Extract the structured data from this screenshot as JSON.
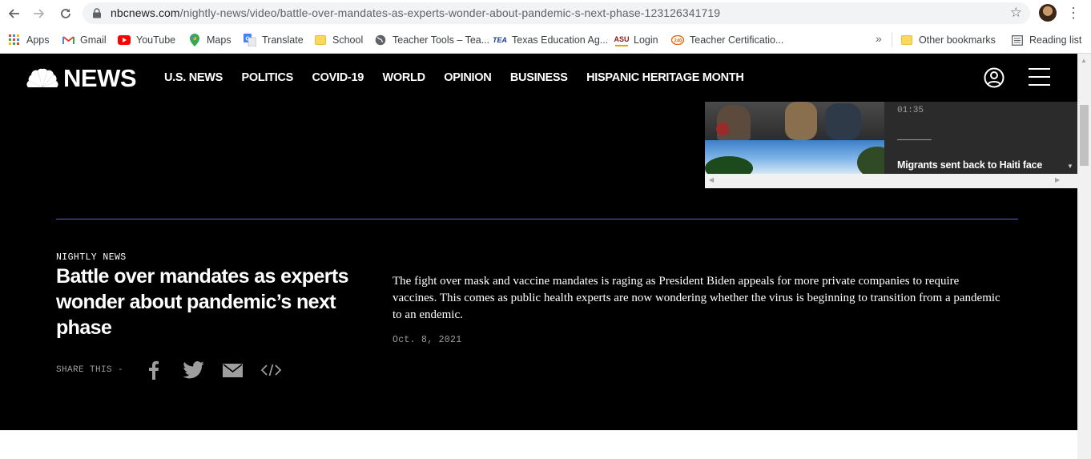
{
  "browser": {
    "url_host": "nbcnews.com",
    "url_path": "/nightly-news/video/battle-over-mandates-as-experts-wonder-about-pandemic-s-next-phase-123126341719",
    "bookmarks": [
      {
        "label": "Apps",
        "icon": "apps-grid-icon"
      },
      {
        "label": "Gmail",
        "icon": "gmail-icon"
      },
      {
        "label": "YouTube",
        "icon": "youtube-icon"
      },
      {
        "label": "Maps",
        "icon": "maps-pin-icon"
      },
      {
        "label": "Translate",
        "icon": "translate-icon"
      },
      {
        "label": "School",
        "icon": "folder-icon"
      },
      {
        "label": "Teacher Tools – Tea...",
        "icon": "globe-icon"
      },
      {
        "label": "Texas Education Ag...",
        "icon": "tea-icon"
      },
      {
        "label": "Login",
        "icon": "asu-icon"
      },
      {
        "label": "Teacher Certificatio...",
        "icon": "certification-icon"
      }
    ],
    "overflow_chevron": "»",
    "other_bookmarks": "Other bookmarks",
    "reading_list": "Reading list"
  },
  "site": {
    "logo_text": "NEWS",
    "nav": [
      "U.S. NEWS",
      "POLITICS",
      "COVID-19",
      "WORLD",
      "OPINION",
      "BUSINESS",
      "HISPANIC HERITAGE MONTH"
    ]
  },
  "playlist": {
    "time": "01:35",
    "next_title": "Migrants sent back to Haiti face"
  },
  "article": {
    "kicker": "NIGHTLY NEWS",
    "headline": "Battle over mandates as experts wonder about pandemic’s next phase",
    "dek": "The fight over mask and vaccine mandates is raging as President Biden appeals for more private companies to require vaccines. This comes as public health experts are now wondering whether the virus is beginning to transition from a pandemic to an endemic.",
    "date": "Oct. 8, 2021",
    "share_label": "SHARE THIS -"
  },
  "colors": {
    "background": "#000000",
    "accent_rule": "#5b5bd6",
    "muted_text": "#9e9e9e"
  }
}
